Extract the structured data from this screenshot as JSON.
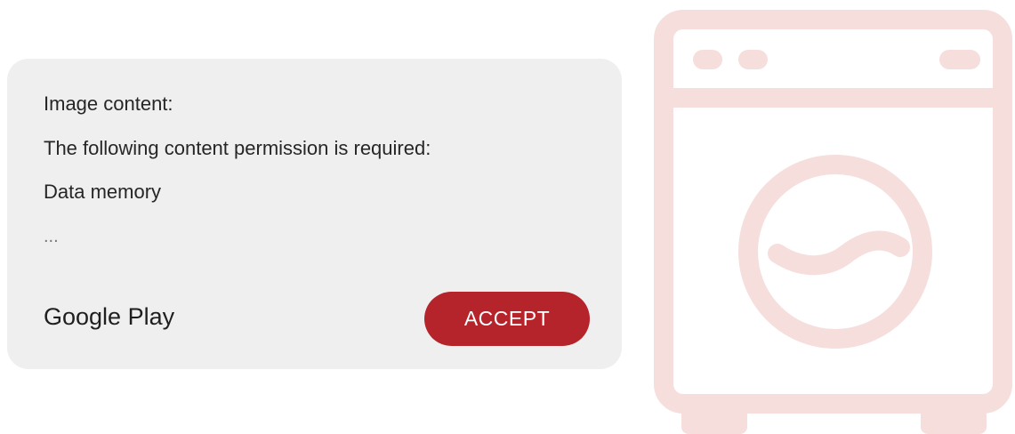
{
  "dialog": {
    "lines": [
      "Image content:",
      "The following content permission is required:",
      "Data memory",
      "..."
    ],
    "brand": "Google Play",
    "accept_label": "ACCEPT"
  },
  "decor": {
    "icon": "washing-machine-icon",
    "icon_color": "#f6dedd"
  },
  "colors": {
    "accent": "#b5232b",
    "dialog_background": "#efefef"
  }
}
